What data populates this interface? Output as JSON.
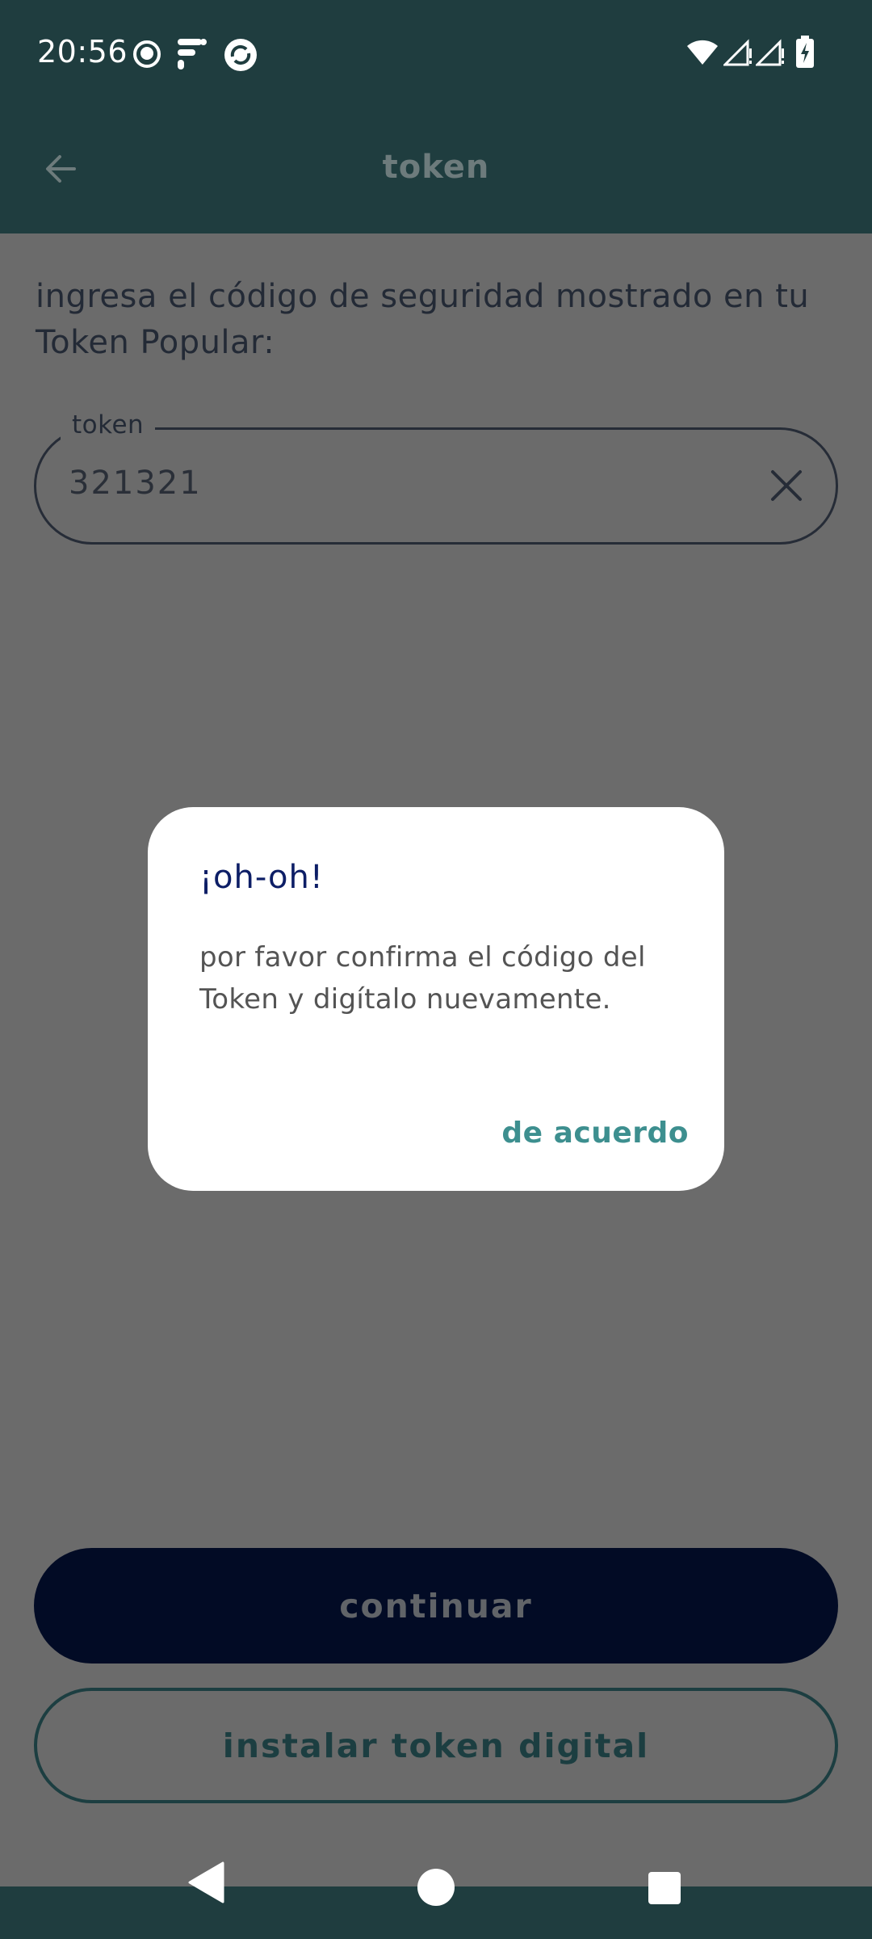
{
  "status_bar": {
    "time": "20:56",
    "icons": [
      "emoji-notification-icon",
      "feed-notification-icon",
      "sync-notification-icon",
      "wifi-icon",
      "signal-icon",
      "signal-icon",
      "battery-charging-icon"
    ]
  },
  "app_bar": {
    "title": "token",
    "back_icon": "arrow-left-icon"
  },
  "content": {
    "instruction": "ingresa el código de seguridad mostrado en tu Token Popular:",
    "token_field": {
      "label": "token",
      "value": "321321",
      "clear_icon": "close-icon"
    },
    "continue_label": "continuar",
    "install_label": "instalar token digital"
  },
  "dialog": {
    "title": "¡oh-oh!",
    "message": "por favor confirma el código del Token y digítalo nuevamente.",
    "ok_label": "de acuerdo"
  },
  "nav_bar": {
    "icons": [
      "back-triangle-icon",
      "home-circle-icon",
      "recents-square-icon"
    ]
  },
  "colors": {
    "bar_background": "#1f3d3f",
    "scrim_background": "#6b6b6b",
    "dialog_title": "#0d1e66",
    "dialog_action": "#3d8f8f",
    "primary_button": "#020b25"
  }
}
